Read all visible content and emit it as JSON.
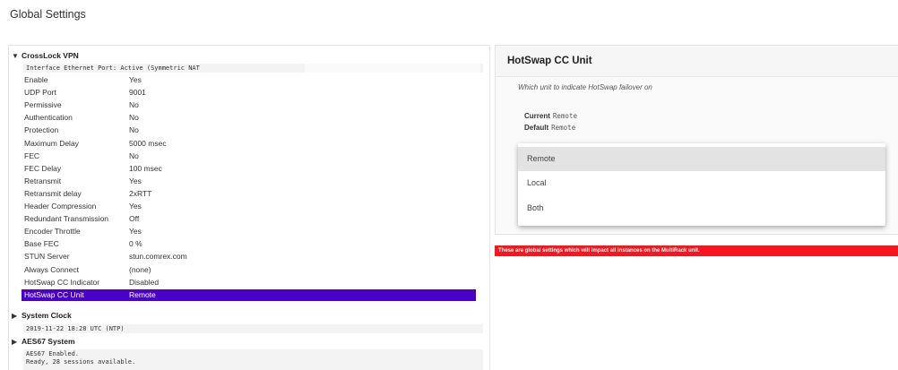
{
  "page": {
    "title": "Global Settings"
  },
  "tree": {
    "crosslock": {
      "label": "CrossLock VPN",
      "interface_line": "Interface Ethernet Port: Active (Symmetric NAT",
      "rows": [
        {
          "key": "Enable",
          "value": "Yes"
        },
        {
          "key": "UDP Port",
          "value": "9001"
        },
        {
          "key": "Permissive",
          "value": "No"
        },
        {
          "key": "Authentication",
          "value": "No"
        },
        {
          "key": "Protection",
          "value": "No"
        },
        {
          "key": "Maximum Delay",
          "value": "5000 msec"
        },
        {
          "key": "FEC",
          "value": "No"
        },
        {
          "key": "FEC Delay",
          "value": "100 msec"
        },
        {
          "key": "Retransmit",
          "value": "Yes"
        },
        {
          "key": "Retransmit delay",
          "value": "2xRTT"
        },
        {
          "key": "Header Compression",
          "value": "Yes"
        },
        {
          "key": "Redundant Transmission",
          "value": "Off"
        },
        {
          "key": "Encoder Throttle",
          "value": "Yes"
        },
        {
          "key": "Base FEC",
          "value": "0 %"
        },
        {
          "key": "STUN Server",
          "value": "stun.comrex.com"
        },
        {
          "key": "Always Connect",
          "value": "(none)"
        },
        {
          "key": "HotSwap CC Indicator",
          "value": "Disabled"
        },
        {
          "key": "HotSwap CC Unit",
          "value": "Remote"
        }
      ]
    },
    "system_clock": {
      "label": "System Clock",
      "line": "2019-11-22 18:28 UTC (NTP)"
    },
    "aes67": {
      "label": "AES67 System",
      "line1": "AES67 Enabled.",
      "line2": "Ready, 28 sessions available."
    }
  },
  "detail": {
    "title": "HotSwap CC Unit",
    "description": "Which unit to indicate HotSwap failover on",
    "current_label": "Current",
    "current_value": "Remote",
    "default_label": "Default",
    "default_value": "Remote",
    "options": [
      "Remote",
      "Local",
      "Both"
    ],
    "selected_option": "Remote"
  },
  "warning": "These are global settings which will impact all instances on the MultiRack unit.",
  "colors": {
    "selected_row": "#4b00c9",
    "warning": "#f7161e"
  }
}
